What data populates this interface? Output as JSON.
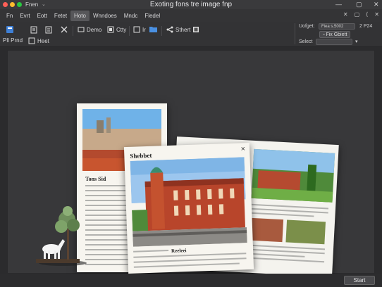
{
  "titlebar": {
    "app_name": "Fnen",
    "app_caret": "⌄",
    "title": "Exoting fons tre image fnp",
    "controls": [
      "✕",
      "▢",
      "⟨",
      "✕"
    ]
  },
  "window_controls": [
    "—",
    "▢",
    "✕"
  ],
  "menu": {
    "items": [
      "Fn",
      "Evrt",
      "Eott",
      "Fetet",
      "Hoto",
      "Wnndoes",
      "Mndc",
      "Fledel"
    ],
    "active_index": 4
  },
  "toolbar": {
    "pdf_label": "Pll Prnd",
    "heet_label": "Heet",
    "demo_label": "Demo",
    "city_label": "Ctty",
    "ir_label": "Ir",
    "start_label": "Sthert"
  },
  "right_panel": {
    "upright_label": "Uofget:",
    "upright_value": "Fiea s.5002",
    "size_value": "2 P24",
    "fix_button": "Fix Gbiett",
    "select_label": "Select",
    "select_value": ""
  },
  "page_left": {
    "title": "Tons Sid"
  },
  "page_front": {
    "header": "Shebbet",
    "caption": "Reeleei"
  },
  "footer": {
    "start_button": "Start"
  }
}
